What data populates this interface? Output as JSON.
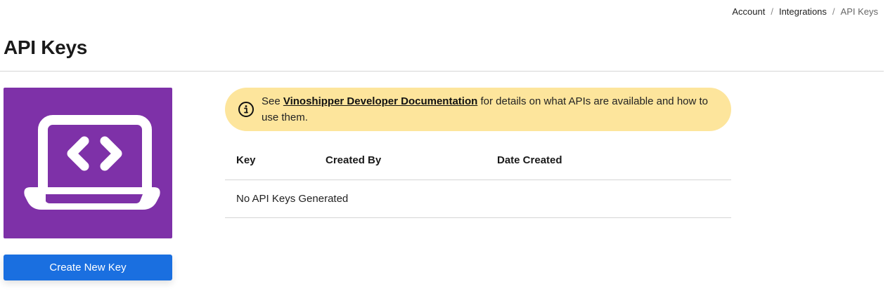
{
  "breadcrumb": {
    "items": [
      "Account",
      "Integrations"
    ],
    "current": "API Keys",
    "separator": "/"
  },
  "page": {
    "title": "API Keys"
  },
  "hero": {
    "icon": "laptop-code-icon",
    "background_color": "#7e31a8"
  },
  "actions": {
    "create_label": "Create New Key",
    "button_color": "#1a6fe0"
  },
  "notice": {
    "icon": "info-circle-icon",
    "prefix": "See ",
    "link_text": "Vinoshipper Developer Documentation",
    "suffix": " for details on what APIs are available and how to use them.",
    "background_color": "#fde59c"
  },
  "table": {
    "columns": [
      "Key",
      "Created By",
      "Date Created"
    ],
    "empty_message": "No API Keys Generated"
  }
}
